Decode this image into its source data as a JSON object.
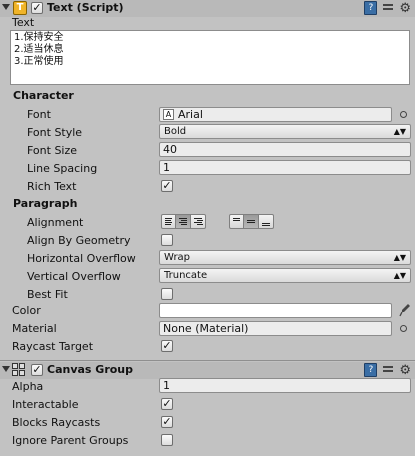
{
  "text_component": {
    "title": "Text (Script)",
    "text_label": "Text",
    "text_lines": [
      "1.保持安全",
      "2.适当休息",
      "3.正常使用"
    ],
    "character_heading": "Character",
    "font_label": "Font",
    "font_value": "Arial",
    "font_style_label": "Font Style",
    "font_style_value": "Bold",
    "font_size_label": "Font Size",
    "font_size_value": "40",
    "line_spacing_label": "Line Spacing",
    "line_spacing_value": "1",
    "rich_text_label": "Rich Text",
    "paragraph_heading": "Paragraph",
    "alignment_label": "Alignment",
    "align_by_geometry_label": "Align By Geometry",
    "horizontal_overflow_label": "Horizontal Overflow",
    "horizontal_overflow_value": "Wrap",
    "vertical_overflow_label": "Vertical Overflow",
    "vertical_overflow_value": "Truncate",
    "best_fit_label": "Best Fit",
    "color_label": "Color",
    "material_label": "Material",
    "material_value": "None (Material)",
    "raycast_target_label": "Raycast Target"
  },
  "canvas_group": {
    "title": "Canvas Group",
    "alpha_label": "Alpha",
    "alpha_value": "1",
    "interactable_label": "Interactable",
    "blocks_raycasts_label": "Blocks Raycasts",
    "ignore_parent_groups_label": "Ignore Parent Groups"
  },
  "icons": {
    "script_icon": "script-T-icon",
    "help": "book-icon",
    "preset": "layout-icon",
    "settings": "gear-icon"
  },
  "checkmark": "✓",
  "colors": {
    "panel_bg": "#c2c2c2",
    "header_bg": "#b9b9b9",
    "color_swatch": "#ffffff"
  }
}
